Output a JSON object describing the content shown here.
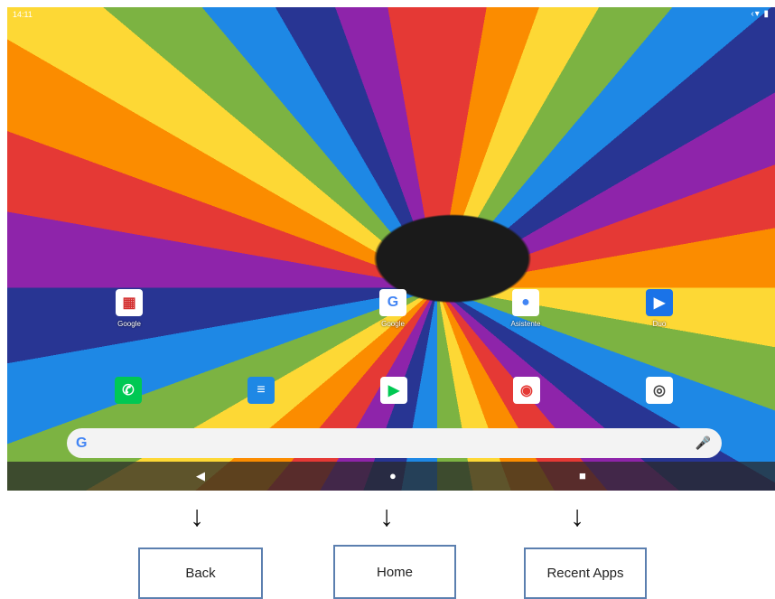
{
  "status_bar": {
    "time": "14:11",
    "icons": "‹▾ ▮"
  },
  "apps": [
    {
      "label": "Google",
      "icon": "folder-icon",
      "glyph": "▦",
      "color": "#ffffff",
      "fg": "#d32f2f"
    },
    {
      "label": "Google",
      "icon": "google-icon",
      "glyph": "G",
      "color": "#ffffff",
      "fg": "#4285f4"
    },
    {
      "label": "Asistente",
      "icon": "assistant-icon",
      "glyph": "●",
      "color": "#ffffff",
      "fg": "#4285f4"
    },
    {
      "label": "Duo",
      "icon": "duo-icon",
      "glyph": "▶",
      "color": "#1a73e8",
      "fg": "#ffffff"
    }
  ],
  "dock": [
    {
      "icon": "phone-icon",
      "glyph": "✆",
      "color": "#00c853",
      "fg": "#ffffff"
    },
    {
      "icon": "messages-icon",
      "glyph": "≡",
      "color": "#1e88e5",
      "fg": "#ffffff"
    },
    {
      "icon": "play-store-icon",
      "glyph": "▶",
      "color": "#ffffff",
      "fg": "#00c853"
    },
    {
      "icon": "chrome-icon",
      "glyph": "◉",
      "color": "#ffffff",
      "fg": "#e53935"
    },
    {
      "icon": "camera-icon",
      "glyph": "◎",
      "color": "#ffffff",
      "fg": "#444444"
    }
  ],
  "search": {
    "logo": "G",
    "mic": "🎤"
  },
  "nav": {
    "back": "◀",
    "home": "●",
    "recent": "■"
  },
  "annotations": {
    "arrow": "↓",
    "back": "Back",
    "home": "Home",
    "recent": "Recent Apps"
  }
}
